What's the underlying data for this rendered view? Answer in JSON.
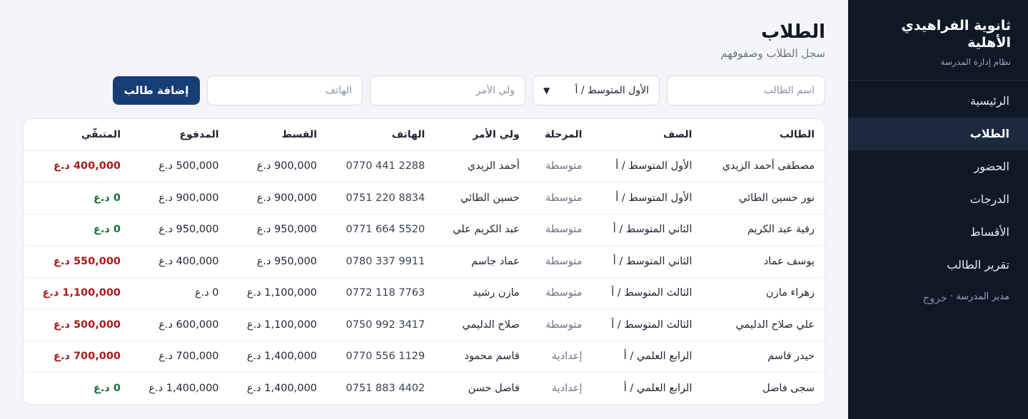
{
  "sidebar": {
    "title": "ثانوية الفراهيدي الأهلية",
    "subtitle": "نظام إدارة المدرسة",
    "items": [
      {
        "label": "الرئيسية",
        "active": false
      },
      {
        "label": "الطلاب",
        "active": true
      },
      {
        "label": "الحضور",
        "active": false
      },
      {
        "label": "الدرجات",
        "active": false
      },
      {
        "label": "الأقساط",
        "active": false
      },
      {
        "label": "تقرير الطالب",
        "active": false
      }
    ],
    "user": "مدير المدرسة ·",
    "logout": "خروج"
  },
  "header": {
    "title": "الطلاب",
    "subtitle": "سجل الطلاب وصفوفهم"
  },
  "form": {
    "name_placeholder": "اسم الطالب",
    "class_value": "الأول المتوسط / أ",
    "guardian_placeholder": "ولي الأمر",
    "phone_placeholder": "الهاتف",
    "add_label": "إضافة طالب"
  },
  "table": {
    "headers": [
      "الطالب",
      "الصف",
      "المرحلة",
      "ولي الأمر",
      "الهاتف",
      "القسط",
      "المدفوع",
      "المتبقّي"
    ],
    "rows": [
      {
        "student": "مصطفى أحمد الزيدي",
        "class": "الأول المتوسط / أ",
        "stage": "متوسطة",
        "guardian": "أحمد الزيدي",
        "phone": "0770 441 2288",
        "fee": "900,000 د.ع",
        "paid": "500,000 د.ع",
        "remaining": "400,000 د.ع",
        "status": "due"
      },
      {
        "student": "نور حسين الطائي",
        "class": "الأول المتوسط / أ",
        "stage": "متوسطة",
        "guardian": "حسين الطائي",
        "phone": "0751 220 8834",
        "fee": "900,000 د.ع",
        "paid": "900,000 د.ع",
        "remaining": "0 د.ع",
        "status": "clear"
      },
      {
        "student": "رقية عبد الكريم",
        "class": "الثاني المتوسط / أ",
        "stage": "متوسطة",
        "guardian": "عبد الكريم علي",
        "phone": "0771 664 5520",
        "fee": "950,000 د.ع",
        "paid": "950,000 د.ع",
        "remaining": "0 د.ع",
        "status": "clear"
      },
      {
        "student": "يوسف عماد",
        "class": "الثاني المتوسط / أ",
        "stage": "متوسطة",
        "guardian": "عماد جاسم",
        "phone": "0780 337 9911",
        "fee": "950,000 د.ع",
        "paid": "400,000 د.ع",
        "remaining": "550,000 د.ع",
        "status": "due"
      },
      {
        "student": "زهراء مازن",
        "class": "الثالث المتوسط / أ",
        "stage": "متوسطة",
        "guardian": "مازن رشيد",
        "phone": "0772 118 7763",
        "fee": "1,100,000 د.ع",
        "paid": "0 د.ع",
        "remaining": "1,100,000 د.ع",
        "status": "due"
      },
      {
        "student": "علي صلاح الدليمي",
        "class": "الثالث المتوسط / أ",
        "stage": "متوسطة",
        "guardian": "صلاح الدليمي",
        "phone": "0750 992 3417",
        "fee": "1,100,000 د.ع",
        "paid": "600,000 د.ع",
        "remaining": "500,000 د.ع",
        "status": "due"
      },
      {
        "student": "حيدر قاسم",
        "class": "الرابع العلمي / أ",
        "stage": "إعدادية",
        "guardian": "قاسم محمود",
        "phone": "0770 556 1129",
        "fee": "1,400,000 د.ع",
        "paid": "700,000 د.ع",
        "remaining": "700,000 د.ع",
        "status": "due"
      },
      {
        "student": "سجى فاضل",
        "class": "الرابع العلمي / أ",
        "stage": "إعدادية",
        "guardian": "فاضل حسن",
        "phone": "0751 883 4402",
        "fee": "1,400,000 د.ع",
        "paid": "1,400,000 د.ع",
        "remaining": "0 د.ع",
        "status": "clear"
      }
    ]
  },
  "colors": {
    "sidebar_bg": "#0f1826",
    "accent": "#173d77",
    "due": "#a8191c",
    "clear": "#17703a"
  }
}
